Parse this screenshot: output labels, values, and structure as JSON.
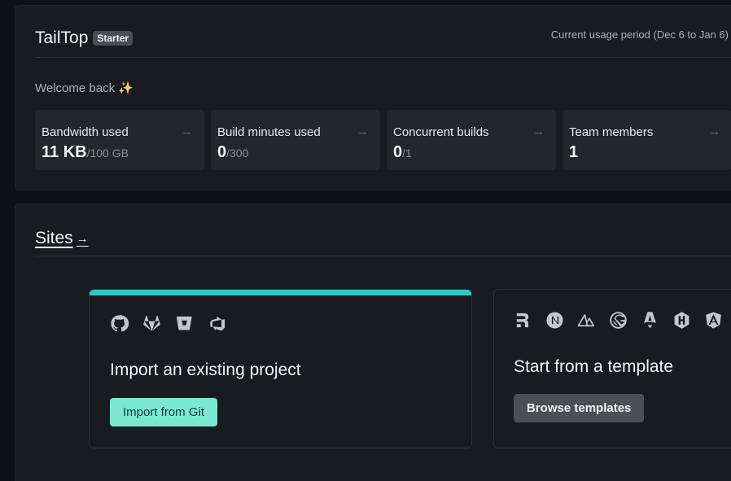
{
  "team": {
    "name": "TailTop",
    "plan_badge": "Starter",
    "usage_period": "Current usage period (Dec 6 to Jan 6)",
    "welcome": "Welcome back",
    "welcome_emoji": "✨"
  },
  "stats": [
    {
      "label": "Bandwidth used",
      "value": "11 KB",
      "limit": "/100 GB",
      "arrow": "→"
    },
    {
      "label": "Build minutes used",
      "value": "0",
      "limit": "/300",
      "arrow": "→"
    },
    {
      "label": "Concurrent builds",
      "value": "0",
      "limit": "/1",
      "arrow": "→"
    },
    {
      "label": "Team members",
      "value": "1",
      "limit": "",
      "arrow": "→"
    }
  ],
  "sites": {
    "title": "Sites",
    "arrow": "→",
    "import_card": {
      "icons": [
        "github-icon",
        "gitlab-icon",
        "bitbucket-icon",
        "azure-devops-icon"
      ],
      "title": "Import an existing project",
      "button": "Import from Git",
      "accent_color": "#2fc9c4"
    },
    "template_card": {
      "icons": [
        "remix-icon",
        "nextjs-icon",
        "nuxt-icon",
        "gatsby-icon",
        "astro-icon",
        "hugo-icon",
        "angular-icon"
      ],
      "title": "Start from a template",
      "button": "Browse templates"
    }
  },
  "colors": {
    "primary_button": "#7ae8d2",
    "accent": "#2fc9c4",
    "panel_bg": "#181b20",
    "page_bg": "#0d1114"
  }
}
